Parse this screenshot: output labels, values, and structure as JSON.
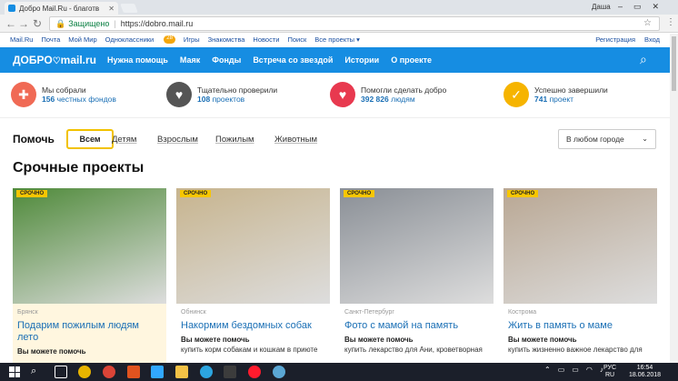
{
  "browser": {
    "tab_title": "Добро Mail.Ru - благотв",
    "user": "Даша",
    "secure_label": "Защищено",
    "url": "https://dobro.mail.ru"
  },
  "portal": {
    "links": [
      "Mail.Ru",
      "Почта",
      "Мой Мир",
      "Одноклассники",
      "Игры",
      "Знакомства",
      "Новости",
      "Поиск",
      "Все проекты ▾"
    ],
    "ok_badge": "28",
    "register": "Регистрация",
    "login": "Вход"
  },
  "header": {
    "logo_left": "ДОБРО",
    "logo_right": "mail.ru",
    "nav": [
      "Нужна помощь",
      "Маяк",
      "Фонды",
      "Встреча со звездой",
      "Истории",
      "О проекте"
    ]
  },
  "stats": [
    {
      "line1": "Мы собрали",
      "num": "156",
      "rest": "честных фондов",
      "color": "#f06a55",
      "icon": "lifebuoy-icon"
    },
    {
      "line1": "Тщательно проверили",
      "num": "108",
      "rest": "проектов",
      "color": "#555555",
      "icon": "magnifier-heart-icon"
    },
    {
      "line1": "Помогли сделать добро",
      "num": "392 826",
      "rest": "людям",
      "color": "#e8394f",
      "icon": "heart-icon"
    },
    {
      "line1": "Успешно завершили",
      "num": "741",
      "rest": "проект",
      "color": "#f6b400",
      "icon": "check-badge-icon"
    }
  ],
  "filters": {
    "help": "Помочь",
    "all": "Всем",
    "items": [
      "Детям",
      "Взрослым",
      "Пожилым",
      "Животным"
    ],
    "city": "В любом городе"
  },
  "section_title": "Срочные проекты",
  "cards": [
    {
      "badge": "СРОЧНО",
      "loc": "Брянск",
      "title": "Подарим пожилым людям лето",
      "can": "Вы можете помочь",
      "desc": "",
      "bg": "#fff6df",
      "img": "#4f8a3a"
    },
    {
      "badge": "СРОЧНО",
      "loc": "Обнинск",
      "title": "Накормим бездомных собак",
      "can": "Вы можете помочь",
      "desc": "купить корм собакам и кошкам в приюте",
      "bg": "#ffffff",
      "img": "#c7b48e"
    },
    {
      "badge": "СРОЧНО",
      "loc": "Санкт-Петербург",
      "title": "Фото с мамой на память",
      "can": "Вы можете помочь",
      "desc": "купить лекарство для Ани, кроветворная",
      "bg": "#ffffff",
      "img": "#8a8f96"
    },
    {
      "badge": "СРОЧНО",
      "loc": "Кострома",
      "title": "Жить в память о маме",
      "can": "Вы можете помочь",
      "desc": "купить жизненно важное лекарство для",
      "bg": "#ffffff",
      "img": "#b9a793"
    }
  ],
  "taskbar": {
    "lang": "РУС",
    "lang2": "RU",
    "time": "16:54",
    "date": "18.06.2018"
  }
}
